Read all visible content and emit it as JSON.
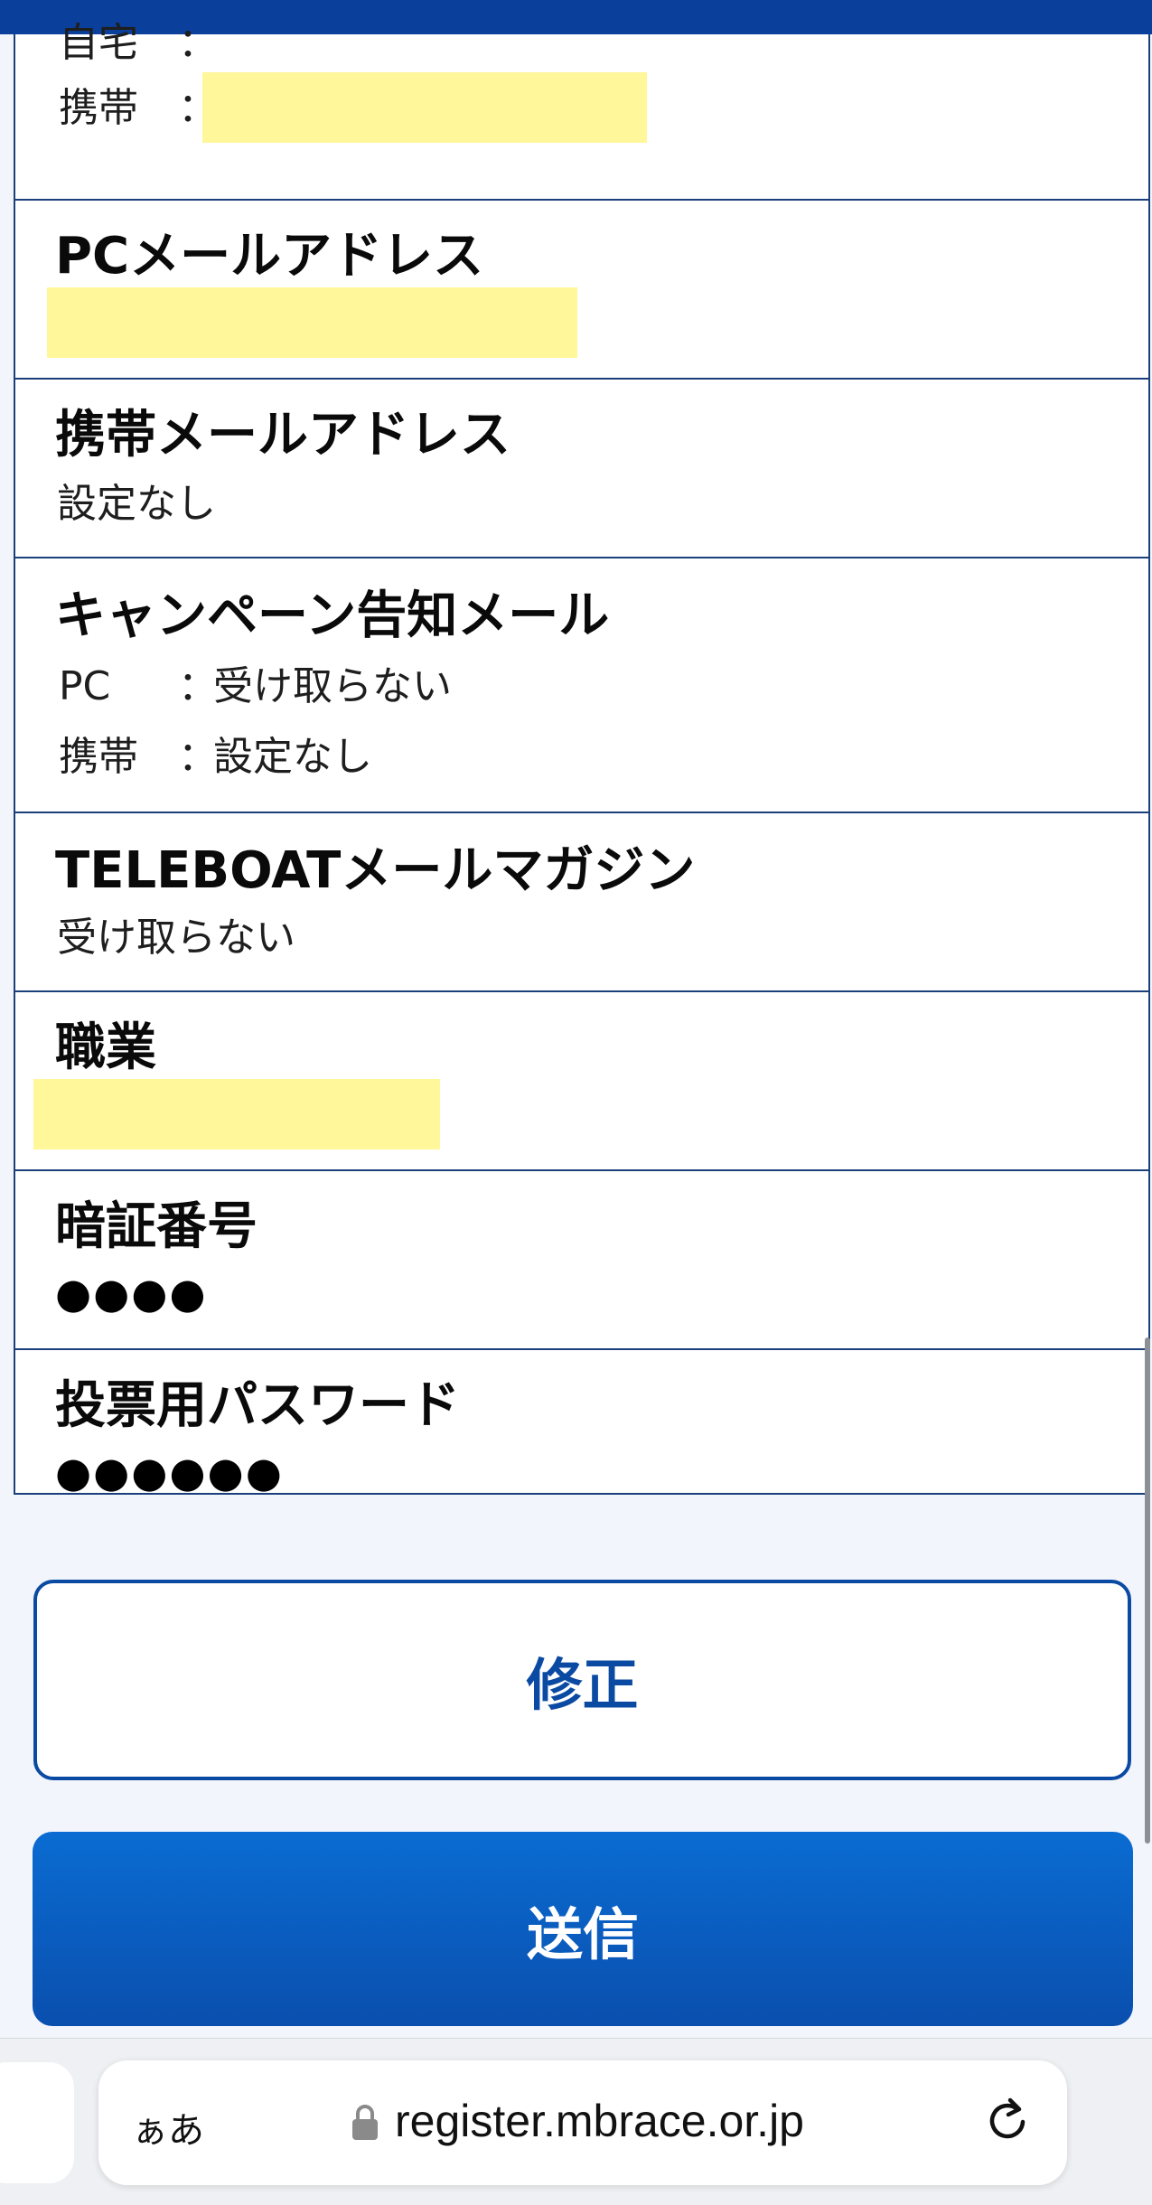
{
  "contact_phone": {
    "home_label": "自宅",
    "mobile_label": "携帯",
    "colon": "："
  },
  "pc_email": {
    "label": "PCメールアドレス"
  },
  "mobile_email": {
    "label": "携帯メールアドレス",
    "value": "設定なし"
  },
  "campaign_mail": {
    "label": "キャンペーン告知メール",
    "pc_label": "PC",
    "pc_value": "受け取らない",
    "mobile_label": "携帯",
    "mobile_value": "設定なし",
    "colon": "："
  },
  "teleboat_magazine": {
    "label": "TELEBOATメールマガジン",
    "value": "受け取らない"
  },
  "occupation": {
    "label": "職業"
  },
  "pin": {
    "label": "暗証番号",
    "value": "●●●●"
  },
  "vote_password": {
    "label": "投票用パスワード",
    "value": "●●●●●●"
  },
  "buttons": {
    "edit": "修正",
    "submit": "送信"
  },
  "browser": {
    "text_size_label": "ぁあ",
    "url": "register.mbrace.or.jp"
  },
  "colors": {
    "brand_blue": "#0b4aa3",
    "highlight": "#fff799"
  }
}
